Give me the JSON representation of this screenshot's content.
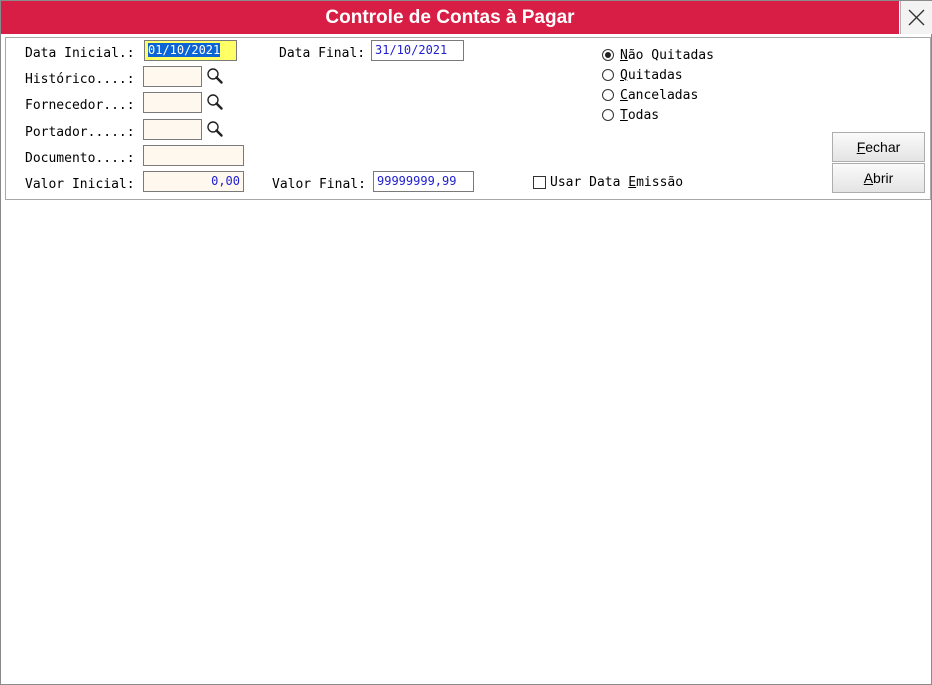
{
  "window": {
    "title": "Controle de Contas à Pagar"
  },
  "filters": {
    "data_inicial": {
      "label": "Data Inicial.:",
      "value": "01/10/2021"
    },
    "data_final": {
      "label": "Data Final:",
      "value": "31/10/2021"
    },
    "historico": {
      "label": "Histórico....:",
      "value": ""
    },
    "fornecedor": {
      "label": "Fornecedor...:",
      "value": ""
    },
    "portador": {
      "label": "Portador.....:",
      "value": ""
    },
    "documento": {
      "label": "Documento....:",
      "value": ""
    },
    "valor_inicial": {
      "label": "Valor Inicial:",
      "value": "0,00"
    },
    "valor_final": {
      "label": "Valor Final:",
      "value": "99999999,99"
    }
  },
  "status_options": [
    {
      "label": "Não Quitadas",
      "mnemonic": "N",
      "checked": true
    },
    {
      "label": "Quitadas",
      "mnemonic": "Q",
      "checked": false
    },
    {
      "label": "Canceladas",
      "mnemonic": "C",
      "checked": false
    },
    {
      "label": "Todas",
      "mnemonic": "T",
      "checked": false
    }
  ],
  "usar_data_emissao": {
    "label": "Usar Data Emissão",
    "checked": false
  },
  "buttons": {
    "fechar": "Fechar",
    "abrir": "Abrir"
  },
  "icons": {
    "search": "magnifier-icon",
    "close": "close-icon"
  },
  "colors": {
    "titlebar": "#d81e45",
    "field_bg": "#fff8ef",
    "field_text": "#2020d0",
    "selection": "#0a64d6"
  }
}
